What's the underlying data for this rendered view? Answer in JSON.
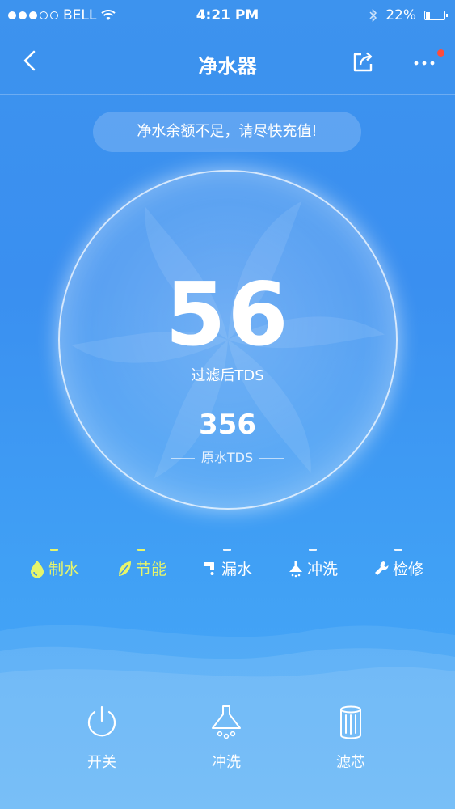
{
  "status_bar": {
    "carrier": "BELL",
    "time": "4:21 PM",
    "battery": "22%",
    "battery_level": 0.22,
    "signal_filled": 3,
    "signal_total": 5
  },
  "nav": {
    "title": "净水器",
    "back_icon": "chevron-left-icon",
    "share_icon": "share-icon",
    "more_icon": "more-icon",
    "notification_dot_color": "#ff4c3b"
  },
  "banner": {
    "text": "净水余额不足，请尽快充值!"
  },
  "gauge": {
    "filtered_value": "56",
    "filtered_label": "过滤后TDS",
    "raw_value": "356",
    "raw_label": "原水TDS"
  },
  "statuses": [
    {
      "label": "制水",
      "icon": "water-drop-icon",
      "active": true
    },
    {
      "label": "节能",
      "icon": "leaf-icon",
      "active": true
    },
    {
      "label": "漏水",
      "icon": "faucet-icon",
      "active": false
    },
    {
      "label": "冲洗",
      "icon": "shower-icon",
      "active": false
    },
    {
      "label": "检修",
      "icon": "wrench-icon",
      "active": false
    }
  ],
  "colors": {
    "background": "#3d93ee",
    "active_status": "#e6f56b"
  },
  "actions": [
    {
      "label": "开关",
      "icon": "power-icon"
    },
    {
      "label": "冲洗",
      "icon": "flush-icon"
    },
    {
      "label": "滤芯",
      "icon": "filter-cartridge-icon"
    }
  ]
}
